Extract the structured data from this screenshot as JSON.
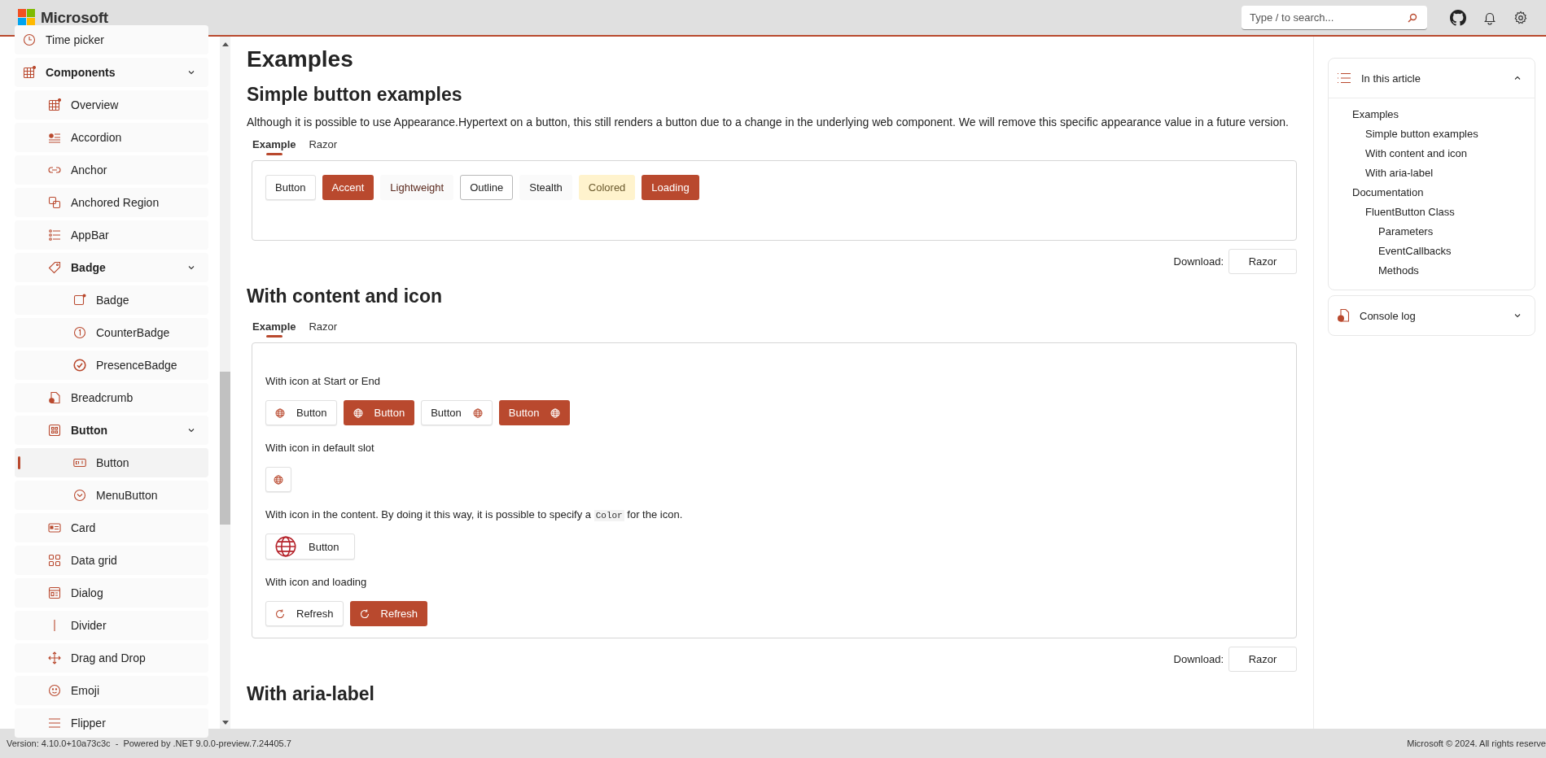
{
  "header": {
    "logo_text": "Microsoft",
    "search": {
      "placeholder": "Type / to search..."
    }
  },
  "sidebar": {
    "items": [
      {
        "label": "Time picker",
        "selected": false
      },
      {
        "label": "Components",
        "selected": false,
        "expanded": true,
        "children": [
          {
            "label": "Overview",
            "selected": false
          },
          {
            "label": "Accordion",
            "selected": false
          },
          {
            "label": "Anchor",
            "selected": false
          },
          {
            "label": "Anchored Region",
            "selected": false
          },
          {
            "label": "AppBar",
            "selected": false
          },
          {
            "label": "Badge",
            "selected": false,
            "expanded": true,
            "children": [
              {
                "label": "Badge",
                "selected": false
              },
              {
                "label": "CounterBadge",
                "selected": false
              },
              {
                "label": "PresenceBadge",
                "selected": false
              }
            ]
          },
          {
            "label": "Breadcrumb",
            "selected": false
          },
          {
            "label": "Button",
            "selected": false,
            "expanded": true,
            "children": [
              {
                "label": "Button",
                "selected": true
              },
              {
                "label": "MenuButton",
                "selected": false
              }
            ]
          },
          {
            "label": "Card",
            "selected": false
          },
          {
            "label": "Data grid",
            "selected": false
          },
          {
            "label": "Dialog",
            "selected": false
          },
          {
            "label": "Divider",
            "selected": false
          },
          {
            "label": "Drag and Drop",
            "selected": false
          },
          {
            "label": "Emoji",
            "selected": false
          },
          {
            "label": "Flipper",
            "selected": false
          }
        ]
      }
    ]
  },
  "main": {
    "title": "Examples",
    "sections": [
      {
        "heading": "Simple button examples",
        "description": "Although it is possible to use Appearance.Hypertext on a button, this still renders a button due to a change in the underlying web component. We will remove this specific appearance value in a future version.",
        "tabs": [
          {
            "label": "Example",
            "selected": true
          },
          {
            "label": "Razor",
            "selected": false
          }
        ],
        "groups": [
          {
            "buttons": [
              {
                "label": "Button",
                "kind": "neutral"
              },
              {
                "label": "Accent",
                "kind": "accent"
              },
              {
                "label": "Lightweight",
                "kind": "lightweight"
              },
              {
                "label": "Outline",
                "kind": "outline"
              },
              {
                "label": "Stealth",
                "kind": "stealth"
              },
              {
                "label": "Colored",
                "kind": "colored"
              },
              {
                "label": "Loading",
                "kind": "accent"
              }
            ]
          }
        ],
        "download": {
          "label": "Download:",
          "button": "Razor"
        }
      },
      {
        "heading": "With content and icon",
        "tabs": [
          {
            "label": "Example",
            "selected": true
          },
          {
            "label": "Razor",
            "selected": false
          }
        ],
        "groups": [
          {
            "caption": {
              "text": "With icon at Start or End"
            },
            "buttons": [
              {
                "label": "Button",
                "kind": "neutral"
              },
              {
                "label": "Button",
                "kind": "accent"
              },
              {
                "label": "Button",
                "kind": "neutral"
              },
              {
                "label": "Button",
                "kind": "accent"
              }
            ]
          },
          {
            "caption": {
              "text": "With icon in default slot"
            },
            "buttons": [
              {
                "kind": "neutral"
              }
            ]
          },
          {
            "caption": {
              "text": "With icon in the content. By doing it this way, it is possible to specify a ",
              "code": "Color",
              "after": " for the icon."
            },
            "buttons": [
              {
                "label": "Button",
                "kind": "neutral"
              }
            ]
          },
          {
            "caption": {
              "text": "With icon and loading"
            },
            "buttons": [
              {
                "label": "Refresh",
                "kind": "neutral"
              },
              {
                "label": "Refresh",
                "kind": "accent"
              }
            ]
          }
        ],
        "download": {
          "label": "Download:",
          "button": "Razor"
        }
      },
      {
        "heading": "With aria-label"
      }
    ]
  },
  "aside": {
    "toc": {
      "title": "In this article",
      "expanded": true,
      "items": [
        {
          "label": "Examples",
          "children": [
            {
              "label": "Simple button examples"
            },
            {
              "label": "With content and icon"
            },
            {
              "label": "With aria-label"
            }
          ]
        },
        {
          "label": "Documentation",
          "children": [
            {
              "label": "FluentButton Class",
              "children": [
                {
                  "label": "Parameters"
                },
                {
                  "label": "EventCallbacks"
                },
                {
                  "label": "Methods"
                }
              ]
            }
          ]
        }
      ]
    },
    "console": {
      "title": "Console log",
      "expanded": false
    }
  },
  "footer": {
    "version": "Version: 4.10.0+10a73c3c  -  Powered by .NET 9.0.0-preview.7.24405.7",
    "copyright": "Microsoft © 2024. All rights reserve"
  }
}
